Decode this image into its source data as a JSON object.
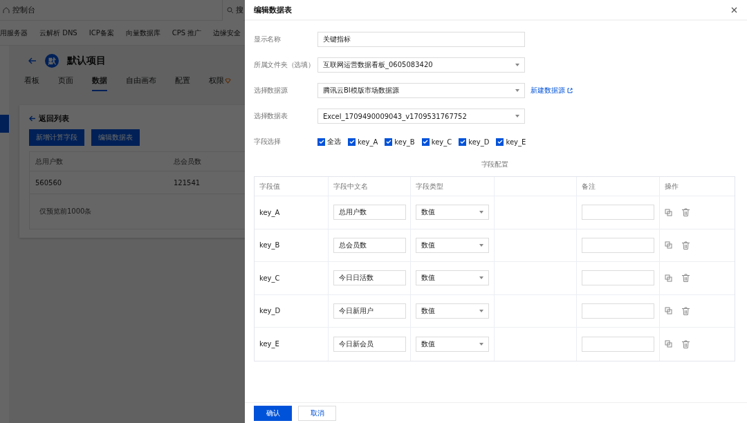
{
  "background": {
    "topbar": {
      "title": "控制台",
      "search": "搜"
    },
    "nav": [
      "用服务器",
      "云解析 DNS",
      "ICP备案",
      "向量数据库",
      "CPS 推广",
      "边缘安全"
    ],
    "project": {
      "avatar": "默",
      "name": "默认项目"
    },
    "tabs": [
      {
        "label": "看板",
        "selected": false
      },
      {
        "label": "页面",
        "selected": false
      },
      {
        "label": "数据",
        "selected": true
      },
      {
        "label": "自由画布",
        "selected": false
      },
      {
        "label": "配置",
        "selected": false
      },
      {
        "label": "权限",
        "selected": false
      }
    ],
    "card": {
      "back": "返回列表",
      "buttons": [
        "新增计算字段",
        "编辑数据表"
      ],
      "columns": [
        "总用户数",
        "总会员数"
      ],
      "rows": [
        [
          "560560",
          "121541"
        ]
      ],
      "footer": "仅预览前1000条"
    }
  },
  "drawer": {
    "title": "编辑数据表",
    "fields": [
      {
        "kind": "input",
        "label": "显示名称",
        "value": "关键指标"
      },
      {
        "kind": "select",
        "label": "所属文件夹（选填）",
        "value": "互联网运营数据看板_0605083420"
      },
      {
        "kind": "select",
        "label": "选择数据源",
        "value": "腾讯云BI模版市场数据源",
        "link": "新建数据源"
      },
      {
        "kind": "select",
        "label": "选择数据表",
        "value": "Excel_1709490009043_v1709531767752"
      }
    ],
    "field_select": {
      "label": "字段选择",
      "options": [
        {
          "label": "全选",
          "checked": true
        },
        {
          "label": "key_A",
          "checked": true
        },
        {
          "label": "key_B",
          "checked": true
        },
        {
          "label": "key_C",
          "checked": true
        },
        {
          "label": "key_D",
          "checked": true
        },
        {
          "label": "key_E",
          "checked": true
        }
      ]
    },
    "config_label": "字段配置",
    "table": {
      "columns": [
        "字段值",
        "字段中文名",
        "字段类型",
        "",
        "备注",
        "操作"
      ],
      "rows": [
        {
          "key": "key_A",
          "name": "总用户数",
          "type": "数值"
        },
        {
          "key": "key_B",
          "name": "总会员数",
          "type": "数值"
        },
        {
          "key": "key_C",
          "name": "今日日活数",
          "type": "数值"
        },
        {
          "key": "key_D",
          "name": "今日新用户",
          "type": "数值"
        },
        {
          "key": "key_E",
          "name": "今日新会员",
          "type": "数值"
        }
      ]
    },
    "buttons": [
      {
        "label": "确认",
        "primary": true
      },
      {
        "label": "取消",
        "primary": false
      }
    ]
  }
}
